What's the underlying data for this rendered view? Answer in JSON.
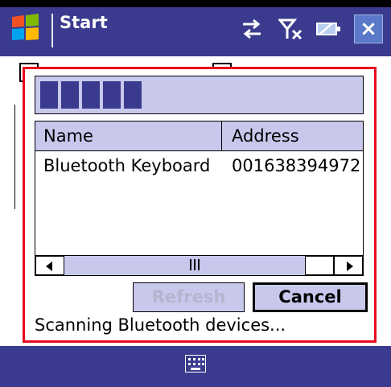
{
  "app": {
    "title": "Start"
  },
  "status_icons": [
    {
      "name": "sync-icon"
    },
    {
      "name": "signal-off-icon"
    },
    {
      "name": "battery-icon"
    }
  ],
  "dialog": {
    "progress_segments": 5,
    "table": {
      "headers": [
        "Name",
        "Address"
      ],
      "rows": [
        {
          "name": "Bluetooth Keyboard",
          "address": "001638394972"
        }
      ]
    },
    "buttons": {
      "refresh": "Refresh",
      "cancel": "Cancel"
    },
    "status": "Scanning Bluetooth devices..."
  },
  "colors": {
    "bar": "#3a3b8e",
    "dialog_border": "#e8091f",
    "lavender": "#c8c8ed"
  }
}
